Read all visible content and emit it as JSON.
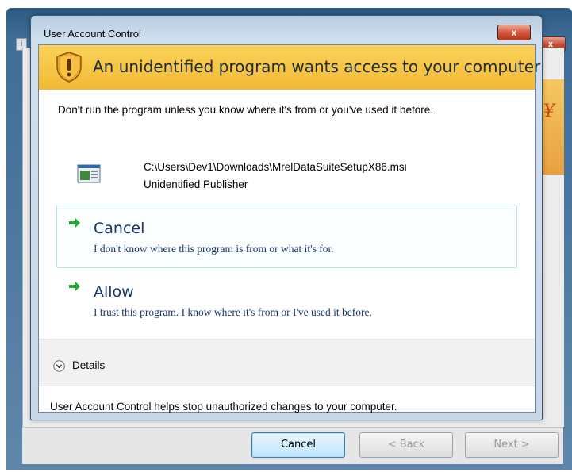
{
  "background_window": {
    "close_label": "x",
    "banner_glyph": "¥",
    "buttons": [
      {
        "label": "Cancel",
        "active": true
      },
      {
        "label": "< Back",
        "active": false
      },
      {
        "label": "Next >",
        "active": false
      }
    ]
  },
  "dialog": {
    "title": "User Account Control",
    "close_label": "x",
    "banner_text": "An unidentified program wants access to your computer",
    "banner_icon": "shield-warning-icon",
    "warning_text": "Don't run the program unless you know where it's from or you've used it before.",
    "program": {
      "icon": "program-installer-icon",
      "path": "C:\\Users\\Dev1\\Downloads\\MrelDataSuiteSetupX86.msi",
      "publisher": "Unidentified Publisher"
    },
    "options": [
      {
        "label": "Cancel",
        "description": "I don't know where this program is from or what it's for."
      },
      {
        "label": "Allow",
        "description": "I trust this program. I know where it's from or I've used it before."
      }
    ],
    "details_label": "Details",
    "footer_text": "User Account Control helps stop unauthorized changes to your computer."
  },
  "colors": {
    "banner": "#f2b933",
    "command_text": "#17366a",
    "arrow": "#1fae2e"
  }
}
